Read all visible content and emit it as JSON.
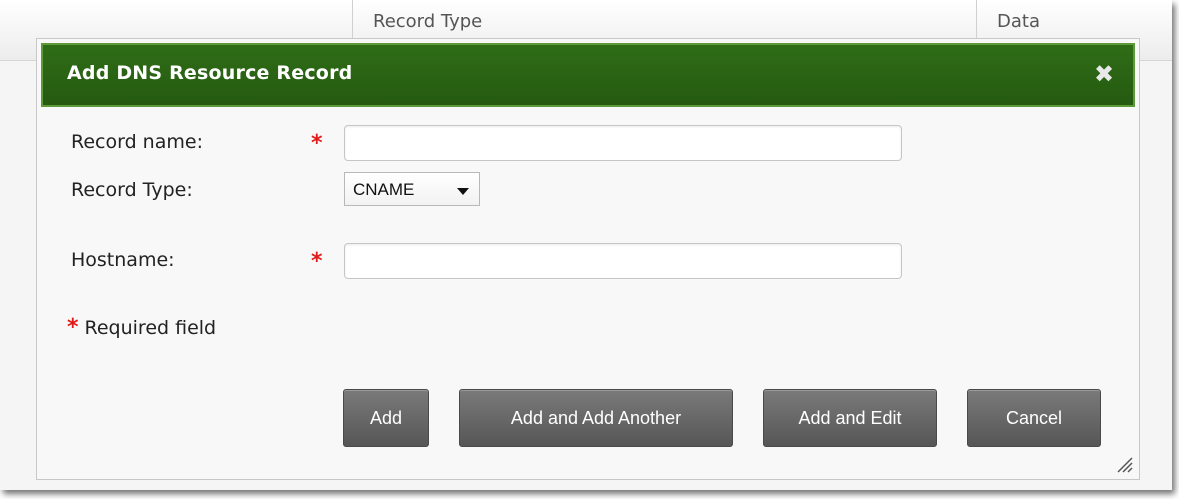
{
  "background_table": {
    "columns": [
      "Record Type",
      "Data"
    ]
  },
  "dialog": {
    "title": "Add DNS Resource Record",
    "close_icon": "close-x-icon",
    "fields": {
      "record_name": {
        "label": "Record name:",
        "required_mark": "*",
        "value": ""
      },
      "record_type": {
        "label": "Record Type:",
        "selected": "CNAME"
      },
      "hostname": {
        "label": "Hostname:",
        "required_mark": "*",
        "value": ""
      }
    },
    "required_note": {
      "mark": "*",
      "text": "Required field"
    },
    "buttons": {
      "add": "Add",
      "add_another": "Add and Add Another",
      "add_edit": "Add and Edit",
      "cancel": "Cancel"
    }
  },
  "colors": {
    "titlebar": "#2a6313",
    "required": "#e01b1b",
    "button": "#666666"
  }
}
